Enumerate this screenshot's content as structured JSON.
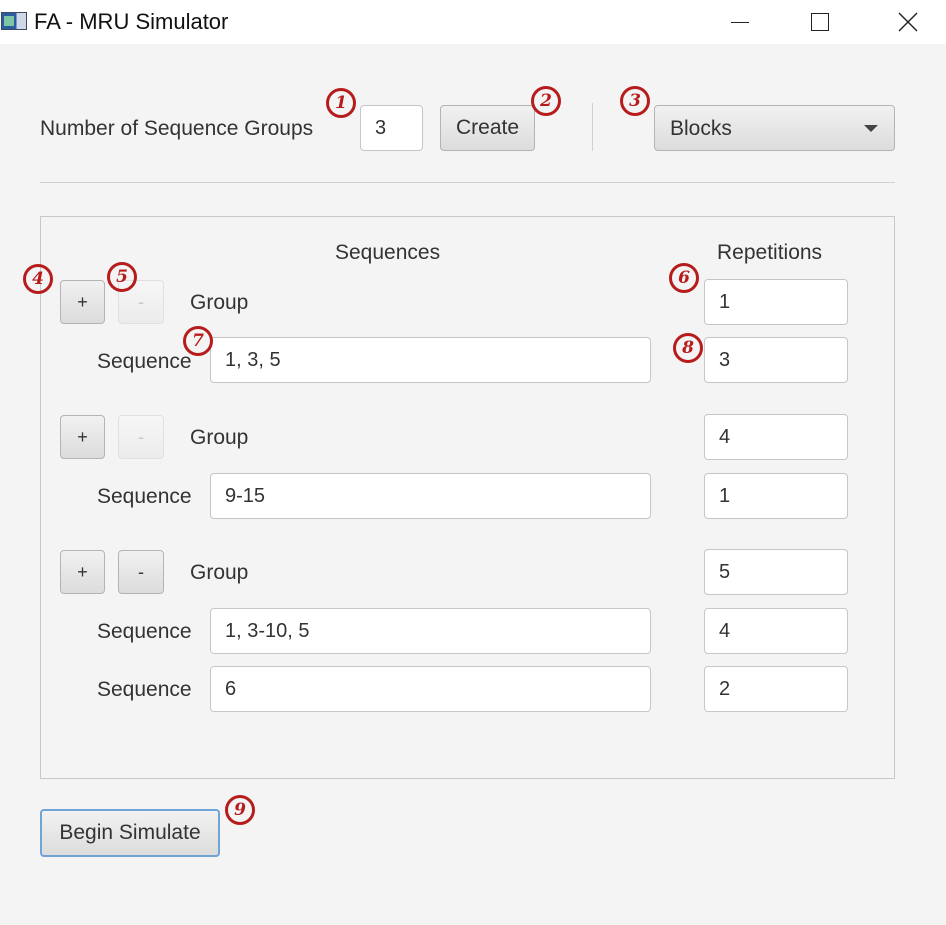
{
  "window": {
    "title": "FA - MRU Simulator"
  },
  "toolbar": {
    "groups_label": "Number of Sequence Groups",
    "groups_value": "3",
    "create_label": "Create",
    "mode_selected": "Blocks"
  },
  "table": {
    "sequences_header": "Sequences",
    "repetitions_header": "Repetitions",
    "groups": [
      {
        "add_label": "+",
        "remove_label": "-",
        "remove_enabled": false,
        "label": "Group",
        "repetitions": "1",
        "sequences": [
          {
            "label": "Sequence",
            "value": "1, 3, 5",
            "repetitions": "3"
          }
        ]
      },
      {
        "add_label": "+",
        "remove_label": "-",
        "remove_enabled": false,
        "label": "Group",
        "repetitions": "4",
        "sequences": [
          {
            "label": "Sequence",
            "value": "9-15",
            "repetitions": "1"
          }
        ]
      },
      {
        "add_label": "+",
        "remove_label": "-",
        "remove_enabled": true,
        "label": "Group",
        "repetitions": "5",
        "sequences": [
          {
            "label": "Sequence",
            "value": "1, 3-10, 5",
            "repetitions": "4"
          },
          {
            "label": "Sequence",
            "value": "6",
            "repetitions": "2"
          }
        ]
      }
    ]
  },
  "footer": {
    "begin_label": "Begin Simulate"
  },
  "annotations": {
    "marker_1": "1",
    "marker_2": "2",
    "marker_3": "3",
    "marker_4": "4",
    "marker_5": "5",
    "marker_6": "6",
    "marker_7": "7",
    "marker_8": "8",
    "marker_9": "9",
    "marker_color": "#b71c1c"
  },
  "icons": {
    "app": "app-window-icon",
    "minimize": "minimize-icon",
    "maximize": "maximize-icon",
    "close": "close-icon",
    "dropdown": "chevron-down-icon"
  }
}
